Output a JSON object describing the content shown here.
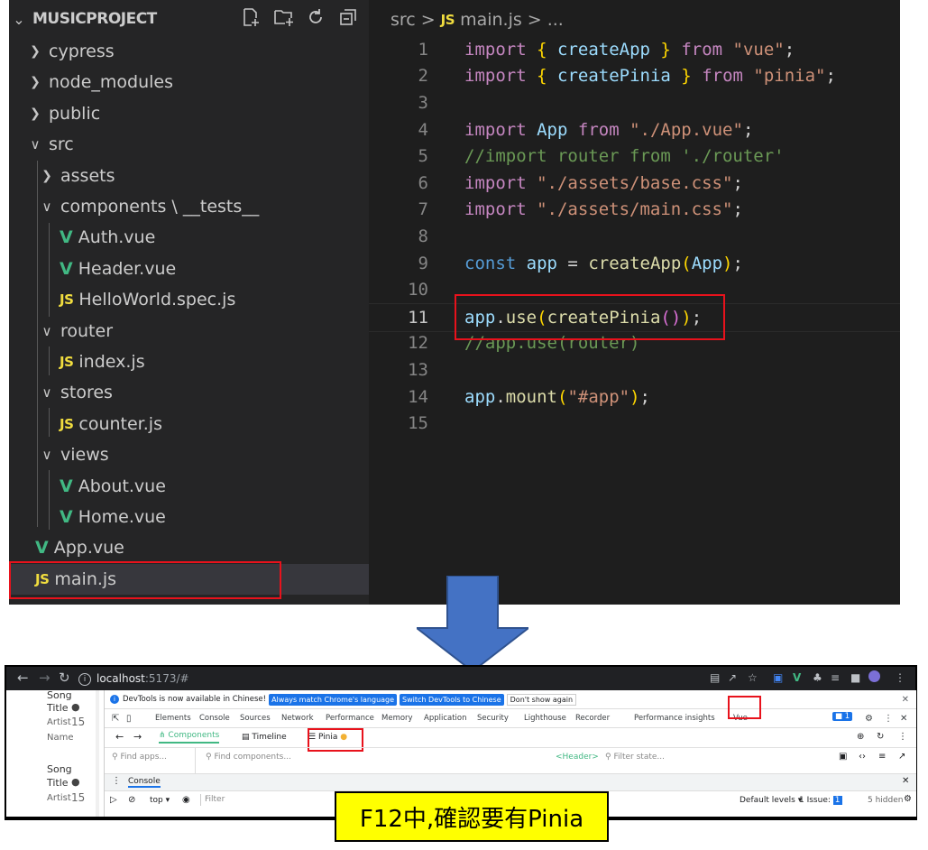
{
  "explorer": {
    "title": "MUSICPROJECT",
    "actions": [
      "new-file-icon",
      "new-folder-icon",
      "refresh-icon",
      "collapse-all-icon"
    ],
    "items": [
      {
        "label": "cypress",
        "type": "folder",
        "depth": 0,
        "open": false
      },
      {
        "label": "node_modules",
        "type": "folder",
        "depth": 0,
        "open": false
      },
      {
        "label": "public",
        "type": "folder",
        "depth": 0,
        "open": false
      },
      {
        "label": "src",
        "type": "folder",
        "depth": 0,
        "open": true
      },
      {
        "label": "assets",
        "type": "folder",
        "depth": 1,
        "open": false
      },
      {
        "label": "components \\ __tests__",
        "type": "folder",
        "depth": 1,
        "open": true
      },
      {
        "label": "Auth.vue",
        "type": "vue",
        "depth": 2
      },
      {
        "label": "Header.vue",
        "type": "vue",
        "depth": 2
      },
      {
        "label": "HelloWorld.spec.js",
        "type": "js",
        "depth": 2
      },
      {
        "label": "router",
        "type": "folder",
        "depth": 1,
        "open": true
      },
      {
        "label": "index.js",
        "type": "js",
        "depth": 2
      },
      {
        "label": "stores",
        "type": "folder",
        "depth": 1,
        "open": true
      },
      {
        "label": "counter.js",
        "type": "js",
        "depth": 2
      },
      {
        "label": "views",
        "type": "folder",
        "depth": 1,
        "open": true
      },
      {
        "label": "About.vue",
        "type": "vue",
        "depth": 2
      },
      {
        "label": "Home.vue",
        "type": "vue",
        "depth": 2
      },
      {
        "label": "App.vue",
        "type": "vue",
        "depth": 1
      },
      {
        "label": "main.js",
        "type": "js",
        "depth": 1,
        "selected": true
      }
    ]
  },
  "editor": {
    "breadcrumb": {
      "folder": "src",
      "sep": ">",
      "file_icon": "JS",
      "file": "main.js",
      "tail": "> ..."
    },
    "current_line": 11,
    "lines": [
      {
        "n": "1",
        "tokens": [
          [
            "kw",
            "import"
          ],
          [
            "pn",
            " "
          ],
          [
            "br",
            "{"
          ],
          [
            "pn",
            " "
          ],
          [
            "var",
            "createApp"
          ],
          [
            "pn",
            " "
          ],
          [
            "br",
            "}"
          ],
          [
            "pn",
            " "
          ],
          [
            "kw",
            "from"
          ],
          [
            "pn",
            " "
          ],
          [
            "str",
            "\"vue\""
          ],
          [
            "pn",
            ";"
          ]
        ]
      },
      {
        "n": "2",
        "tokens": [
          [
            "kw",
            "import"
          ],
          [
            "pn",
            " "
          ],
          [
            "br",
            "{"
          ],
          [
            "pn",
            " "
          ],
          [
            "var",
            "createPinia"
          ],
          [
            "pn",
            " "
          ],
          [
            "br",
            "}"
          ],
          [
            "pn",
            " "
          ],
          [
            "kw",
            "from"
          ],
          [
            "pn",
            " "
          ],
          [
            "str",
            "\"pinia\""
          ],
          [
            "pn",
            ";"
          ]
        ]
      },
      {
        "n": "3",
        "tokens": []
      },
      {
        "n": "4",
        "tokens": [
          [
            "kw",
            "import"
          ],
          [
            "pn",
            " "
          ],
          [
            "var",
            "App"
          ],
          [
            "pn",
            " "
          ],
          [
            "kw",
            "from"
          ],
          [
            "pn",
            " "
          ],
          [
            "str",
            "\"./App.vue\""
          ],
          [
            "pn",
            ";"
          ]
        ]
      },
      {
        "n": "5",
        "tokens": [
          [
            "cm",
            "//import router from './router'"
          ]
        ]
      },
      {
        "n": "6",
        "tokens": [
          [
            "kw",
            "import"
          ],
          [
            "pn",
            " "
          ],
          [
            "str",
            "\"./assets/base.css\""
          ],
          [
            "pn",
            ";"
          ]
        ]
      },
      {
        "n": "7",
        "tokens": [
          [
            "kw",
            "import"
          ],
          [
            "pn",
            " "
          ],
          [
            "str",
            "\"./assets/main.css\""
          ],
          [
            "pn",
            ";"
          ]
        ]
      },
      {
        "n": "8",
        "tokens": []
      },
      {
        "n": "9",
        "tokens": [
          [
            "blue",
            "const"
          ],
          [
            "pn",
            " "
          ],
          [
            "var",
            "app"
          ],
          [
            "pn",
            " = "
          ],
          [
            "fn",
            "createApp"
          ],
          [
            "br",
            "("
          ],
          [
            "var",
            "App"
          ],
          [
            "br",
            ")"
          ],
          [
            "pn",
            ";"
          ]
        ]
      },
      {
        "n": "10",
        "tokens": []
      },
      {
        "n": "11",
        "tokens": [
          [
            "var",
            "app"
          ],
          [
            "pn",
            "."
          ],
          [
            "fn",
            "use"
          ],
          [
            "br",
            "("
          ],
          [
            "fn",
            "createPinia"
          ],
          [
            "br2",
            "()"
          ],
          [
            "br",
            ")"
          ],
          [
            "pn",
            ";"
          ]
        ]
      },
      {
        "n": "12",
        "tokens": [
          [
            "cm",
            "//app.use(router)"
          ]
        ]
      },
      {
        "n": "13",
        "tokens": []
      },
      {
        "n": "14",
        "tokens": [
          [
            "var",
            "app"
          ],
          [
            "pn",
            "."
          ],
          [
            "fn",
            "mount"
          ],
          [
            "br",
            "("
          ],
          [
            "str",
            "\"#app\""
          ],
          [
            "br",
            ")"
          ],
          [
            "pn",
            ";"
          ]
        ]
      },
      {
        "n": "15",
        "tokens": []
      }
    ]
  },
  "browser": {
    "url_host": "localhost",
    "url_rest": ":5173/#",
    "preview": {
      "song_label": "Song",
      "title_label": "Title",
      "artist_label": "Artist",
      "artist_value": "15",
      "name_label": "Name"
    },
    "banner": {
      "text": "DevTools is now available in Chinese!",
      "btn1": "Always match Chrome's language",
      "btn2": "Switch DevTools to Chinese",
      "btn3": "Don't show again"
    },
    "tabs": [
      "Elements",
      "Console",
      "Sources",
      "Network",
      "Performance",
      "Memory",
      "Application",
      "Security",
      "Lighthouse",
      "Recorder",
      "Performance insights",
      "Vue"
    ],
    "issues_badge": "1",
    "vue_tabs": {
      "components": "Components",
      "timeline": "Timeline",
      "pinia": "Pinia"
    },
    "find_apps": "Find apps...",
    "find_components": "Find components...",
    "header_tag": "<Header>",
    "filter_state": "Filter state...",
    "console_label": "Console",
    "console_top": "top",
    "console_filter": "Filter",
    "default_levels": "Default levels",
    "issue_text": "1 Issue:",
    "issue_count": "1",
    "hidden_text": "5 hidden"
  },
  "caption": "F12中,確認要有Pinia",
  "colors": {
    "highlight_red": "#e8121c",
    "arrow_blue": "#4472c4",
    "caption_bg": "#ffff00"
  }
}
